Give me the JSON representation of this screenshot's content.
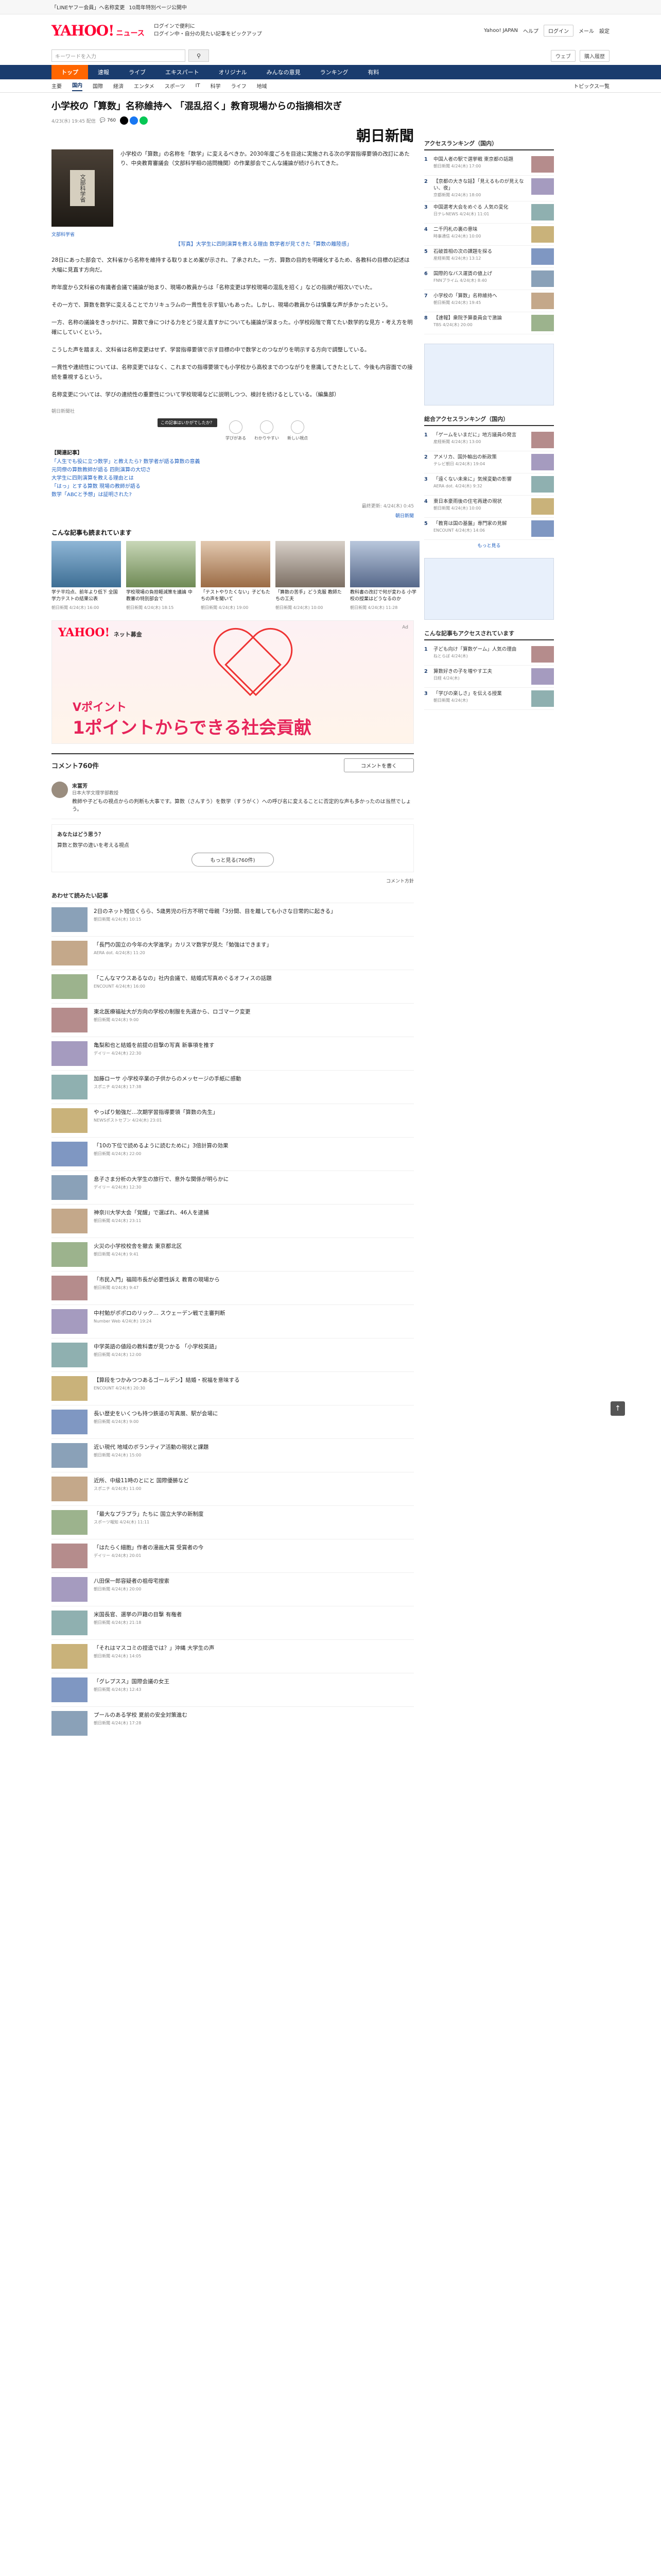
{
  "topstrip": {
    "promo_1": "「LINEヤフー会員」へ名称変更",
    "promo_2": "10周年特別ページ公開中"
  },
  "header": {
    "logo": "YAHOO!",
    "logo_sub": "ニュース",
    "link_1": "Yahoo! JAPAN",
    "link_2": "ヘルプ",
    "promo_line_1": "ログインで便利に",
    "promo_line_2": "ログイン中・自分の見たい記事をピックアップ",
    "login": "ログイン",
    "mail": "メール",
    "settings": "設定"
  },
  "search": {
    "placeholder": "キーワードを入力",
    "button_icon": "search-icon",
    "tool_1": "ウェブ",
    "tool_2": "購入履歴"
  },
  "nav": [
    "トップ",
    "速報",
    "ライブ",
    "エキスパート",
    "オリジナル",
    "みんなの意見",
    "ランキング",
    "有料"
  ],
  "subnav": [
    "主要",
    "国内",
    "国際",
    "経済",
    "エンタメ",
    "スポーツ",
    "IT",
    "科学",
    "ライフ",
    "地域"
  ],
  "subnav_trend": "トピックス一覧",
  "article": {
    "title": "小学校の「算数」名称維持へ 「混乱招く」教育現場からの指摘相次ぎ",
    "date": "4/23(水) 19:45 配信",
    "comments": "760",
    "publisher": "朝日新聞",
    "photo_plate": "文部科学省",
    "photo_credit": "文部科学省",
    "lead": "小学校の「算数」の名称を「数学」に変えるべきか。2030年度ごろを目途に実施される次の学習指導要領の改訂にあたり、中央教育審議会（文部科学相の諮問機関）の作業部会でこんな議論が続けられてきた。",
    "caption": "【写真】大学生に四則演算を教える理由 数学者が見てきた「算数の離陸感」",
    "p1": "28日にあった部会で、文科省から名称を維持する取りまとめ案が示され、了承された。一方、算数の目的を明確化するため、各教科の目標の記述は大幅に見直す方向だ。",
    "p2": "昨年度から文科省の有識者会議で議論が始まり、現場の教員からは「名称変更は学校現場の混乱を招く」などの指摘が相次いでいた。",
    "p3": "その一方で、算数を数学に変えることでカリキュラムの一貫性を示す狙いもあった。しかし、現場の教員からは慎重な声が多かったという。",
    "p4": "一方、名称の議論をきっかけに、算数で身につける力をどう捉え直すかについても議論が深まった。小学校段階で育てたい数学的な見方・考え方を明確にしていくという。",
    "p5": "こうした声を踏まえ、文科省は名称変更はせず、学習指導要領で示す目標の中で数学とのつながりを明示する方向で調整している。",
    "p6": "一貫性や連続性については、名称変更ではなく、これまでの指導要領でも小学校から高校までのつながりを意識してきたとして、今後も内容面での接続を重視するという。",
    "p7": "名称変更については、学びの連続性の重要性について学校現場などに説明しつつ、検討を続けるとしている。（編集部）",
    "byline": "朝日新聞社",
    "reactions": [
      "学びがある",
      "わかりやすい",
      "新しい視点"
    ],
    "tooltip": "この記事はいかがでしたか？",
    "related_heading": "【関連記事】",
    "related": [
      "「人生でも役に立つ数学」と教えたら? 数学者が語る算数の意義",
      "元同僚の算数教師が語る 四則演算の大切さ",
      "大学生に四則演算を教える理由とは",
      "「はっ」とする算数 現場の教師が語る",
      "数学「ABCと予想」は証明された?"
    ],
    "end_date": "最終更新: 4/24(木) 0:45",
    "end_link": "朝日新聞"
  },
  "popular": {
    "title": "こんな記事も読まれています",
    "cards": [
      {
        "text": "学テ平均点、前年より低下 全国学力テストの結果公表",
        "src": "朝日新聞 4/24(木) 16:00"
      },
      {
        "text": "学校現場の負担軽減策を議論 中教審の特別部会で",
        "src": "朝日新聞 4/24(木) 18:15"
      },
      {
        "text": "「テストやりたくない」子どもたちの声を聞いて",
        "src": "朝日新聞 4/24(木) 19:00"
      },
      {
        "text": "「算数の苦手」どう克服 教師たちの工夫",
        "src": "朝日新聞 4/24(木) 10:00"
      },
      {
        "text": "教科書の改訂で何が変わる 小学校の授業はどうなるのか",
        "src": "朝日新聞 4/24(木) 11:28"
      }
    ]
  },
  "ad": {
    "logo": "YAHOO!",
    "logo_sub": "ネット募金",
    "line1": "Vポイント",
    "line2": "1ポイントからできる社会貢献",
    "pr": "Ad"
  },
  "comments": {
    "count_label": "コメント760件",
    "write_button": "コメントを書く",
    "expert_name": "末冨芳",
    "expert_title": "日本大学文理学部教授",
    "expert_body": "教師や子どもの視点からの判断も大事です。算数（さんすう）を数学（すうがく）への呼び名に変えることに否定的な声も多かったのは当然でしょう。",
    "thinking_header": "あなたはどう思う？",
    "thinking_q": "算数と数学の違いを考える視点",
    "more_button": "もっと見る(760件)",
    "check": "コメント方針"
  },
  "recommended": {
    "title": "あわせて読みたい記事",
    "items": [
      {
        "text": "2日のネット短信くらら、5歳男児の行方不明で母親「3分間、目を離しても小さな日常的に起きる」",
        "src": "朝日新聞 4/24(木) 10:15"
      },
      {
        "text": "「長門の国立の今年の大学進学」カリスマ数学が見た「勉強はできます」",
        "src": "AERA dot. 4/24(木) 11:20"
      },
      {
        "text": "「こんなマウスあるなの」社内会議で、結婚式写真めぐるオフィスの話題",
        "src": "ENCOUNT 4/24(木) 16:00"
      },
      {
        "text": "東北医療福祉大が方向の学校の制服を先週から、ロゴマーク変更",
        "src": "朝日新聞 4/24(木) 9:00"
      },
      {
        "text": "亀梨和也と結婚を前提の目撃の写真 新事項を推す",
        "src": "デイリー 4/24(木) 22:30"
      },
      {
        "text": "加藤ローサ 小学校卒業の子供からのメッセージの手紙に感動",
        "src": "スポニチ 4/24(木) 17:38"
      },
      {
        "text": "やっぱり勉強だ…次期学習指導要領「算数の先生」",
        "src": "NEWSポストセブン 4/24(木) 23:01"
      },
      {
        "text": "「10の下位で読めるように読むために」3倍計算の効果",
        "src": "朝日新聞 4/24(木) 22:00"
      },
      {
        "text": "息子さま分析の大学生の旅行で、意外な関係が明らかに",
        "src": "デイリー 4/24(木) 12:30"
      },
      {
        "text": "神奈川大学大会「覚醒」で選ばれ、46人を逮捕",
        "src": "朝日新聞 4/24(木) 23:11"
      },
      {
        "text": "火災の小学校校舎を撤去 東京都北区",
        "src": "朝日新聞 4/24(木) 9:41"
      },
      {
        "text": "「市民入門」福岡市長が必要性訴え 教育の現場から",
        "src": "朝日新聞 4/24(木) 9:47"
      },
      {
        "text": "中村勉がポポロのリック… スウェーデン戦で主審判断",
        "src": "Number Web 4/24(木) 19:24"
      },
      {
        "text": "中学英語の値段の教科書が見つかる 「小学校英語」",
        "src": "朝日新聞 4/24(木) 12:00"
      },
      {
        "text": "【算段をつかみつつあるゴールデン】結婚・祝福を意味する",
        "src": "ENCOUNT 4/24(木) 20:30"
      },
      {
        "text": "長い歴史をいくつも持つ鉄道の写真展、駅が会場に",
        "src": "朝日新聞 4/24(木) 9:00"
      },
      {
        "text": "近い現代 地域のボランティア活動の現状と課題",
        "src": "朝日新聞 4/24(木) 15:00"
      },
      {
        "text": "近所、中級11時のとにと 国際優勝など",
        "src": "スポニチ 4/24(木) 11:00"
      },
      {
        "text": "「最大なプラプラ」たちに 国立大学の新制度",
        "src": "スポーツ報知 4/24(木) 11:11"
      },
      {
        "text": "「はたらく細胞」作者の漫画大賞 受賞者の今",
        "src": "デイリー 4/24(木) 20:01"
      },
      {
        "text": "八田保一郎容疑者の祖母宅搜索",
        "src": "朝日新聞 4/24(木) 20:00"
      },
      {
        "text": "米国長官、選挙の戸籍の目撃 有権者",
        "src": "朝日新聞 4/24(木) 21:18"
      },
      {
        "text": "「それはマスコミの捏造では？」沖縄 大学生の声",
        "src": "朝日新聞 4/24(木) 14:05"
      },
      {
        "text": "「グレプスス」国際会議の女王",
        "src": "朝日新聞 4/24(木) 12:43"
      },
      {
        "text": "プールのある学校 夏前の安全対策進む",
        "src": "朝日新聞 4/24(木) 17:28"
      }
    ]
  },
  "side": {
    "access_title": "アクセスランキング（国内）",
    "access": [
      {
        "n": "1",
        "t": "中国人者の駅で選挙戦 東京都の話題",
        "src": "朝日新聞 4/24(木) 17:00"
      },
      {
        "n": "2",
        "t": "【京都の大きな話】「見えるものが見えない、夜」",
        "src": "京都新聞 4/24(木) 18:00"
      },
      {
        "n": "3",
        "t": "中国選考大会をめぐる 人気の変化",
        "src": "日テレNEWS 4/24(木) 11:01"
      },
      {
        "n": "4",
        "t": "二千円札の裏の意味",
        "src": "時事通信 4/24(木) 10:00"
      },
      {
        "n": "5",
        "t": "石破首相の次の課題を探る",
        "src": "産経新聞 4/24(木) 13:12"
      },
      {
        "n": "6",
        "t": "国際的なバス運賃の値上げ",
        "src": "FNNプライム 4/24(木) 8:40"
      },
      {
        "n": "7",
        "t": "小学校の「算数」名称維持へ",
        "src": "朝日新聞 4/24(木) 19:45"
      },
      {
        "n": "8",
        "t": "【速報】衆院予算委員会で激論",
        "src": "TBS 4/24(木) 20:00"
      }
    ],
    "comment_title": "総合アクセスランキング（国内）",
    "comment": [
      {
        "n": "1",
        "t": "「ゲームをいまだに」地方議員の発言",
        "src": "産経新聞 4/24(木) 13:00"
      },
      {
        "n": "2",
        "t": "アメリカ、国外輸出の新政策",
        "src": "テレビ朝日 4/24(木) 19:04"
      },
      {
        "n": "3",
        "t": "「遠くない未来に」気候変動の影響",
        "src": "AERA dot. 4/24(木) 9:32"
      },
      {
        "n": "4",
        "t": "東日本豪雨後の住宅再建の現状",
        "src": "朝日新聞 4/24(木) 10:00"
      },
      {
        "n": "5",
        "t": "「教育は国の基盤」専門家の見解",
        "src": "ENCOUNT 4/24(木) 14:06"
      }
    ],
    "social_title": "こんな記事もアクセスされています",
    "social": [
      {
        "n": "1",
        "t": "子ども向け「算数ゲーム」人気の理由",
        "src": "ねとらぼ 4/24(木)"
      },
      {
        "n": "2",
        "t": "算数好きの子を増やす工夫",
        "src": "日経 4/24(木)"
      },
      {
        "n": "3",
        "t": "「学びの楽しさ」を伝える授業",
        "src": "朝日新聞 4/24(木)"
      }
    ],
    "more": "もっと見る"
  },
  "totop": "↑"
}
